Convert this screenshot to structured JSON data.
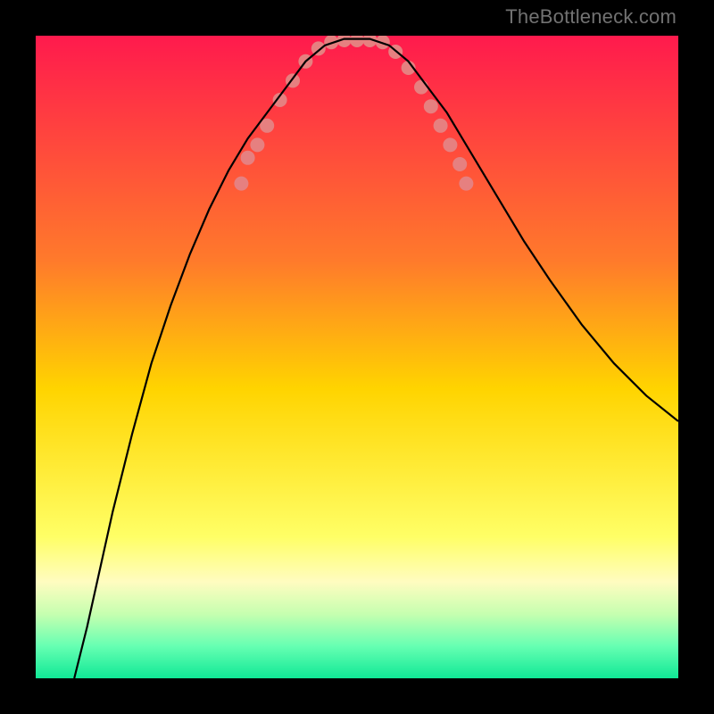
{
  "watermark": {
    "text": "TheBottleneck.com"
  },
  "chart_data": {
    "type": "line",
    "title": "",
    "xlabel": "",
    "ylabel": "",
    "xlim": [
      0,
      100
    ],
    "ylim": [
      0,
      100
    ],
    "background_gradient_stops": [
      {
        "offset": 0,
        "color": "#ff1a4d"
      },
      {
        "offset": 35,
        "color": "#ff7a2b"
      },
      {
        "offset": 55,
        "color": "#ffd400"
      },
      {
        "offset": 78,
        "color": "#ffff66"
      },
      {
        "offset": 85,
        "color": "#fffcc0"
      },
      {
        "offset": 90,
        "color": "#c6ffb0"
      },
      {
        "offset": 95,
        "color": "#66ffb2"
      },
      {
        "offset": 100,
        "color": "#10e896"
      }
    ],
    "series": [
      {
        "name": "bottleneck-curve",
        "color": "#000000",
        "stroke_width": 2.2,
        "points": [
          {
            "x": 6,
            "y": 0
          },
          {
            "x": 8,
            "y": 8
          },
          {
            "x": 10,
            "y": 17
          },
          {
            "x": 12,
            "y": 26
          },
          {
            "x": 15,
            "y": 38
          },
          {
            "x": 18,
            "y": 49
          },
          {
            "x": 21,
            "y": 58
          },
          {
            "x": 24,
            "y": 66
          },
          {
            "x": 27,
            "y": 73
          },
          {
            "x": 30,
            "y": 79
          },
          {
            "x": 33,
            "y": 84
          },
          {
            "x": 36,
            "y": 88
          },
          {
            "x": 39,
            "y": 92
          },
          {
            "x": 42,
            "y": 96
          },
          {
            "x": 45,
            "y": 98.5
          },
          {
            "x": 48,
            "y": 99.5
          },
          {
            "x": 50,
            "y": 99.5
          },
          {
            "x": 52,
            "y": 99.5
          },
          {
            "x": 55,
            "y": 98.5
          },
          {
            "x": 58,
            "y": 96
          },
          {
            "x": 61,
            "y": 92
          },
          {
            "x": 64,
            "y": 88
          },
          {
            "x": 67,
            "y": 83
          },
          {
            "x": 70,
            "y": 78
          },
          {
            "x": 73,
            "y": 73
          },
          {
            "x": 76,
            "y": 68
          },
          {
            "x": 80,
            "y": 62
          },
          {
            "x": 85,
            "y": 55
          },
          {
            "x": 90,
            "y": 49
          },
          {
            "x": 95,
            "y": 44
          },
          {
            "x": 100,
            "y": 40
          }
        ]
      }
    ],
    "markers": {
      "name": "data-points",
      "color": "#e68080",
      "radius": 8,
      "points": [
        {
          "x": 32,
          "y": 77
        },
        {
          "x": 33,
          "y": 81
        },
        {
          "x": 34.5,
          "y": 83
        },
        {
          "x": 36,
          "y": 86
        },
        {
          "x": 38,
          "y": 90
        },
        {
          "x": 40,
          "y": 93
        },
        {
          "x": 42,
          "y": 96
        },
        {
          "x": 44,
          "y": 98
        },
        {
          "x": 46,
          "y": 99
        },
        {
          "x": 48,
          "y": 99.3
        },
        {
          "x": 50,
          "y": 99.3
        },
        {
          "x": 52,
          "y": 99.3
        },
        {
          "x": 54,
          "y": 99
        },
        {
          "x": 56,
          "y": 97.5
        },
        {
          "x": 58,
          "y": 95
        },
        {
          "x": 60,
          "y": 92
        },
        {
          "x": 61.5,
          "y": 89
        },
        {
          "x": 63,
          "y": 86
        },
        {
          "x": 64.5,
          "y": 83
        },
        {
          "x": 66,
          "y": 80
        },
        {
          "x": 67,
          "y": 77
        }
      ]
    }
  }
}
